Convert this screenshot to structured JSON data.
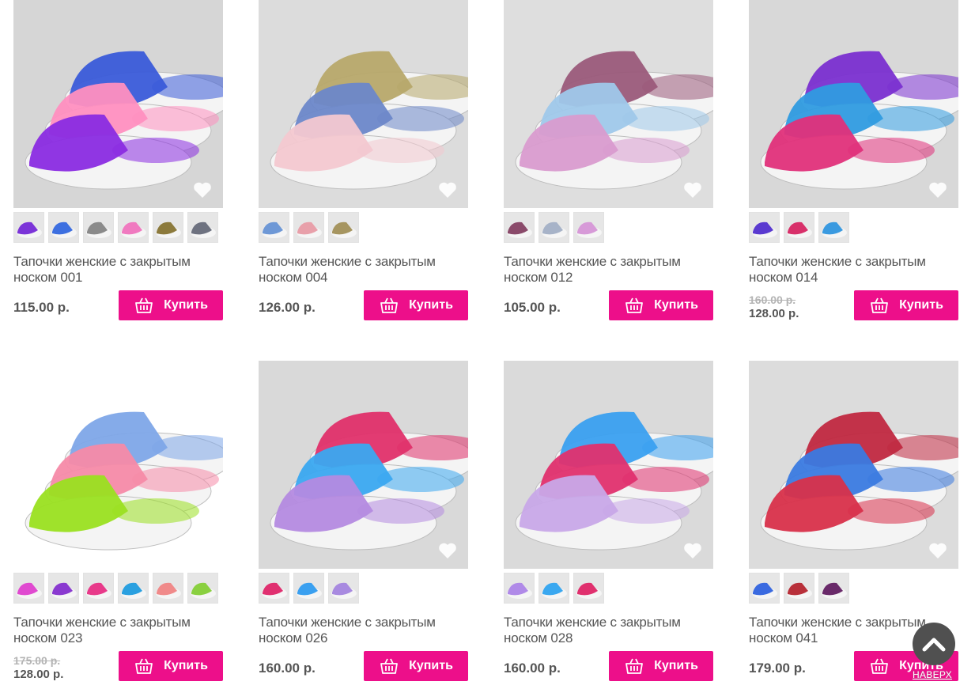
{
  "buy_label": "Купить",
  "scroll_top": {
    "label": "НАВЕРХ",
    "icon": "chevron-up-icon"
  },
  "colors": {
    "accent": "#ed0f8a",
    "text": "#555555",
    "old_price": "#b4b4b4"
  },
  "products": [
    {
      "title": "Тапочки женские с закрытым носком 001",
      "price": "115.00 р.",
      "old_price": null,
      "photo_bg": "#d6d6d6",
      "slippers": [
        "#8a2be2",
        "#ff8fc0",
        "#3a5bd9"
      ],
      "swatches": [
        "#7b34d8",
        "#3d6fe0",
        "#8a8a8a",
        "#f07ac0",
        "#8c7a3c",
        "#6e7280"
      ]
    },
    {
      "title": "Тапочки женские с закрытым носком 004",
      "price": "126.00 р.",
      "old_price": null,
      "photo_bg": "#dcdcdc",
      "slippers": [
        "#f3c8d0",
        "#6b87c9",
        "#b7a86a"
      ],
      "swatches": [
        "#6e98d6",
        "#e8a0aa",
        "#a69560"
      ]
    },
    {
      "title": "Тапочки женские с закрытым носком 012",
      "price": "105.00 р.",
      "old_price": null,
      "photo_bg": "#dedede",
      "slippers": [
        "#d99bcf",
        "#9fc8ea",
        "#9a5a7a"
      ],
      "swatches": [
        "#8a4a6a",
        "#a7b3c8",
        "#d79ad8"
      ]
    },
    {
      "title": "Тапочки женские с закрытым носком 014",
      "price": "128.00 р.",
      "old_price": "160.00 р.",
      "photo_bg": "#d8d8d8",
      "slippers": [
        "#e0307a",
        "#2f9be0",
        "#7a2fd0"
      ],
      "swatches": [
        "#5a3ad0",
        "#d8306a",
        "#3a9ae0"
      ]
    },
    {
      "title": "Тапочки женские с закрытым носком 023",
      "price": "128.00 р.",
      "old_price": "175.00 р.",
      "photo_bg": "#ffffff",
      "slippers": [
        "#9ae020",
        "#f58aa8",
        "#7ea6e8"
      ],
      "swatches": [
        "#e04ad0",
        "#8a3ad0",
        "#e83a8a",
        "#2aa0e0",
        "#f08a8a",
        "#8ad040"
      ]
    },
    {
      "title": "Тапочки женские с закрытым носком 026",
      "price": "160.00 р.",
      "old_price": null,
      "photo_bg": "#d9d9d9",
      "slippers": [
        "#b48ae0",
        "#3aa8f0",
        "#e0306a"
      ],
      "swatches": [
        "#e03070",
        "#3aa0f0",
        "#a88ae0"
      ]
    },
    {
      "title": "Тапочки женские с закрытым носком 028",
      "price": "160.00 р.",
      "old_price": null,
      "photo_bg": "#dadada",
      "slippers": [
        "#c8a8e8",
        "#e0306e",
        "#3aa0f0"
      ],
      "swatches": [
        "#b08ae8",
        "#3aa8f0",
        "#e0306e"
      ]
    },
    {
      "title": "Тапочки женские с закрытым носком 041",
      "price": "179.00 р.",
      "old_price": null,
      "photo_bg": "#dcdcdc",
      "slippers": [
        "#d8304a",
        "#3a7ae0",
        "#c02840"
      ],
      "swatches": [
        "#3a6ae0",
        "#b8303a",
        "#6a2a6a"
      ]
    }
  ]
}
